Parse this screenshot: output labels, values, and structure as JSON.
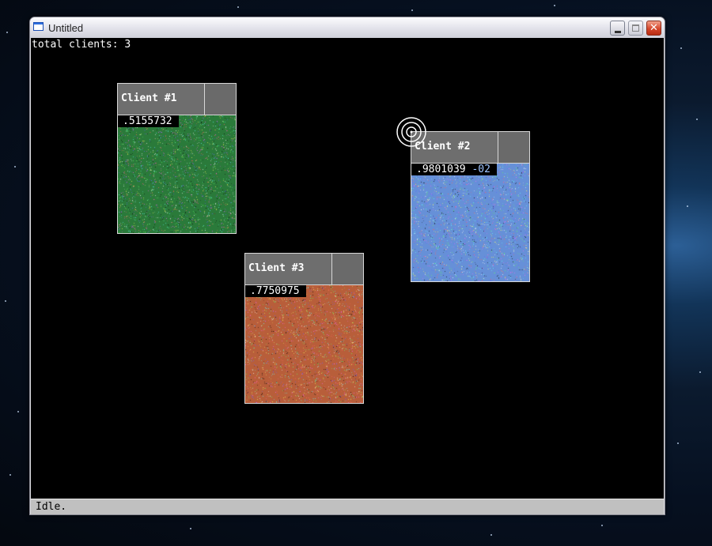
{
  "window": {
    "title": "Untitled"
  },
  "canvas": {
    "total_clients": "total clients: 3"
  },
  "clients": [
    {
      "name": "Client #1",
      "value": ".5155732",
      "exponent": "",
      "color": "#2a7a3a"
    },
    {
      "name": "Client #2",
      "value": ".9801039",
      "exponent": "-02",
      "color": "#6690d8"
    },
    {
      "name": "Client #3",
      "value": ".7750975",
      "exponent": "",
      "color": "#b85e3a"
    }
  ],
  "statusbar": {
    "text": "Idle."
  }
}
